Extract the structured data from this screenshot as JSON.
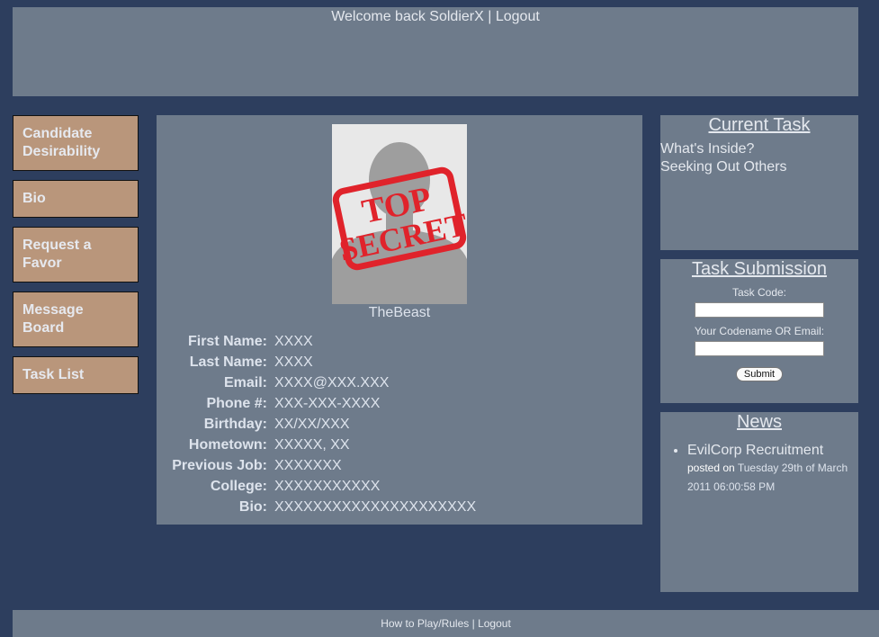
{
  "header": {
    "welcome_text": "Welcome back SoldierX",
    "separator": "|",
    "logout_label": "Logout"
  },
  "sidebar": {
    "items": [
      {
        "label": "Candidate Desirability"
      },
      {
        "label": "Bio"
      },
      {
        "label": "Request a Favor"
      },
      {
        "label": "Message Board"
      },
      {
        "label": "Task List"
      }
    ]
  },
  "profile": {
    "photo_stamp_line1": "TOP",
    "photo_stamp_line2": "SECRET",
    "codename": "TheBeast",
    "fields": [
      {
        "label": "First Name:",
        "value": "XXXX"
      },
      {
        "label": "Last Name:",
        "value": "XXXX"
      },
      {
        "label": "Email:",
        "value": "XXXX@XXX.XXX"
      },
      {
        "label": "Phone #:",
        "value": "XXX-XXX-XXXX"
      },
      {
        "label": "Birthday:",
        "value": "XX/XX/XXX"
      },
      {
        "label": "Hometown:",
        "value": "XXXXX, XX"
      },
      {
        "label": "Previous Job:",
        "value": "XXXXXXX"
      },
      {
        "label": "College:",
        "value": "XXXXXXXXXXX"
      },
      {
        "label": "Bio:",
        "value": "XXXXXXXXXXXXXXXXXXXXX"
      }
    ]
  },
  "current_task": {
    "title": "Current Task",
    "items": [
      "What's Inside?",
      "Seeking Out Others"
    ]
  },
  "task_submission": {
    "title": "Task Submission",
    "code_label": "Task Code:",
    "code_value": "",
    "name_label": "Your Codename OR Email:",
    "name_value": "",
    "submit_label": "Submit"
  },
  "news": {
    "title": "News",
    "items": [
      {
        "headline": "EvilCorp Recruitment",
        "posted_on_label": "posted on",
        "date": "Tuesday 29th of March 2011 06:00:58 PM"
      }
    ]
  },
  "footer": {
    "rules_label": "How to Play/Rules",
    "separator": "|",
    "logout_label": "Logout"
  },
  "colors": {
    "background": "#2d3e5e",
    "panel": "#6e7b8b",
    "sidebar_button": "#b9967b",
    "stamp_red": "#e0232b"
  }
}
